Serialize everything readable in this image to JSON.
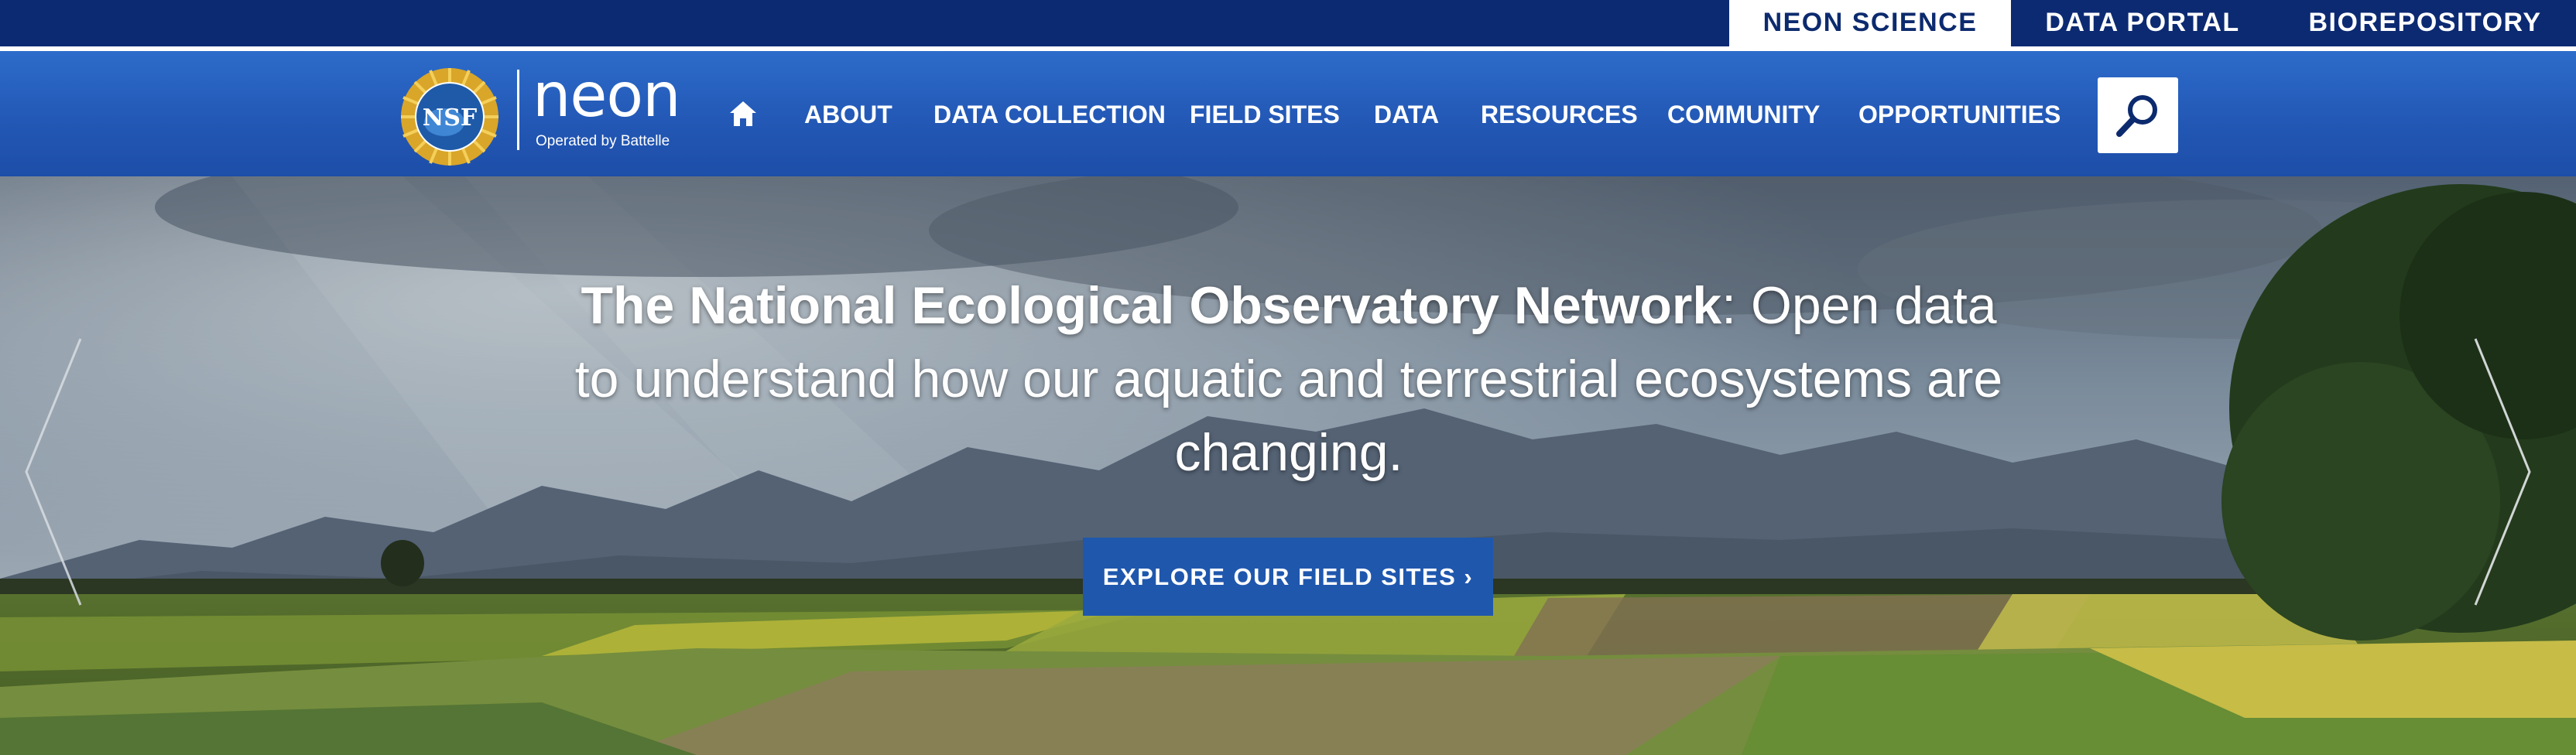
{
  "utility_nav": {
    "items": [
      {
        "label": "NEON SCIENCE",
        "active": true
      },
      {
        "label": "DATA PORTAL",
        "active": false
      },
      {
        "label": "BIOREPOSITORY",
        "active": false
      }
    ]
  },
  "logo": {
    "seal_text": "NSF",
    "wordmark": "neon",
    "subtitle": "Operated by Battelle"
  },
  "main_nav": {
    "home_icon": "home-icon",
    "items": [
      "ABOUT",
      "DATA COLLECTION",
      "FIELD SITES",
      "DATA",
      "RESOURCES",
      "COMMUNITY",
      "OPPORTUNITIES"
    ],
    "search_icon": "search-icon"
  },
  "hero": {
    "headline_bold": "The National Ecological Observatory Network",
    "headline_rest": ": Open data to understand how our aquatic and terrestrial ecosystems are changing.",
    "cta_label": "EXPLORE OUR FIELD SITES ›",
    "prev_icon": "chevron-left-icon",
    "next_icon": "chevron-right-icon"
  },
  "colors": {
    "utility_bar": "#0c2a72",
    "nav_blue": "#2358b6",
    "cta_blue": "#1f57ad",
    "white": "#ffffff"
  }
}
